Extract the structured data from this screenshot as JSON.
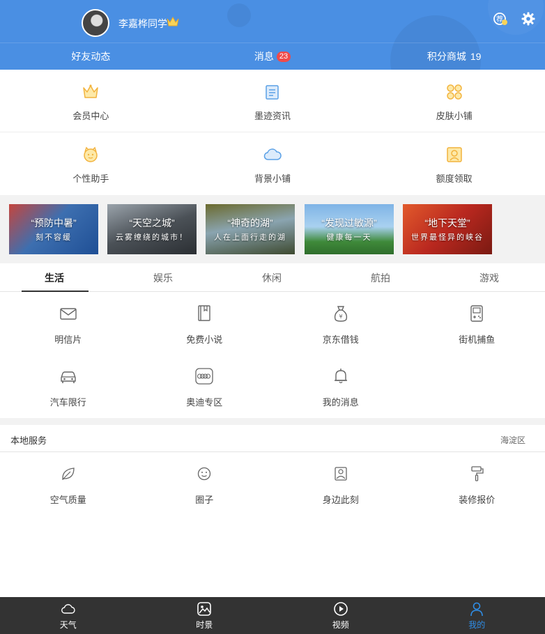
{
  "header": {
    "username": "李嘉桦同学",
    "tabs": [
      {
        "label": "好友动态"
      },
      {
        "label": "消息",
        "badge": "23"
      },
      {
        "label": "积分商城",
        "points": "19"
      }
    ]
  },
  "top_grid": {
    "row1": [
      {
        "label": "会员中心",
        "icon": "crown-icon"
      },
      {
        "label": "墨迹资讯",
        "icon": "news-icon"
      },
      {
        "label": "皮肤小铺",
        "icon": "skin-icon"
      }
    ],
    "row2": [
      {
        "label": "个性助手",
        "icon": "assistant-icon"
      },
      {
        "label": "背景小铺",
        "icon": "cloud-icon"
      },
      {
        "label": "额度领取",
        "icon": "credit-icon"
      }
    ]
  },
  "banners": [
    {
      "title": "“预防中暑”",
      "subtitle": "刻不容缓"
    },
    {
      "title": "“天空之城”",
      "subtitle": "云雾缭绕的城市！"
    },
    {
      "title": "“神奇的湖”",
      "subtitle": "人在上面行走的湖"
    },
    {
      "title": "“发现过敏源”",
      "subtitle": "健康每一天"
    },
    {
      "title": "“地下天堂”",
      "subtitle": "世界最怪异的峡谷"
    }
  ],
  "category_tabs": [
    "生活",
    "娱乐",
    "休闲",
    "航拍",
    "游戏"
  ],
  "apps": {
    "row1": [
      {
        "label": "明信片",
        "icon": "envelope-icon"
      },
      {
        "label": "免费小说",
        "icon": "book-icon"
      },
      {
        "label": "京东借钱",
        "icon": "money-bag-icon"
      },
      {
        "label": "街机捕鱼",
        "icon": "game-console-icon"
      }
    ],
    "row2": [
      {
        "label": "汽车限行",
        "icon": "car-icon"
      },
      {
        "label": "奥迪专区",
        "icon": "audi-icon"
      },
      {
        "label": "我的消息",
        "icon": "bell-icon"
      }
    ]
  },
  "local": {
    "title": "本地服务",
    "district": "海淀区",
    "items": [
      {
        "label": "空气质量",
        "icon": "leaf-icon"
      },
      {
        "label": "圈子",
        "icon": "smiley-icon"
      },
      {
        "label": "身边此刻",
        "icon": "photo-pin-icon"
      },
      {
        "label": "装修报价",
        "icon": "paint-roller-icon"
      }
    ]
  },
  "bottom_nav": [
    {
      "label": "天气",
      "icon": "cloud-icon"
    },
    {
      "label": "时景",
      "icon": "picture-icon"
    },
    {
      "label": "视频",
      "icon": "play-icon"
    },
    {
      "label": "我的",
      "icon": "user-icon",
      "active": true
    }
  ],
  "colors": {
    "header_bg": "#4a8fe3",
    "badge": "#f04a4a",
    "nav_bg": "#333333",
    "nav_active": "#2f8ee8",
    "orange_icon": "#f2b33d",
    "blue_icon": "#5aa0e6"
  }
}
